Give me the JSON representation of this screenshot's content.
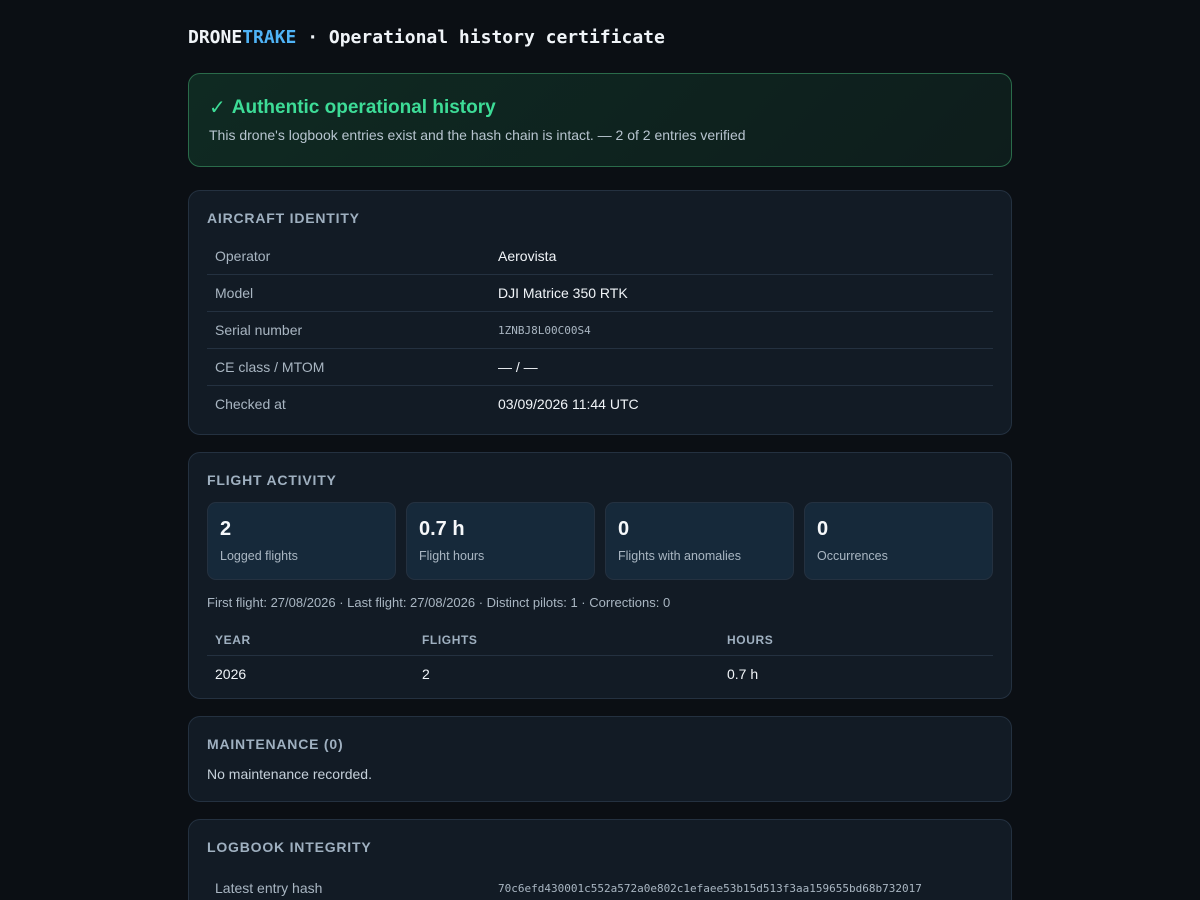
{
  "header": {
    "brand_part1": "DRONE",
    "brand_part2": "TRAKE",
    "title": " · Operational history certificate"
  },
  "banner": {
    "icon": "check-icon",
    "title": "Authentic operational history",
    "subtitle": "This drone's logbook entries exist and the hash chain is intact. — 2 of 2 entries verified"
  },
  "identity": {
    "title": "Aircraft identity",
    "rows": [
      {
        "key": "Operator",
        "value": "Aerovista"
      },
      {
        "key": "Model",
        "value": "DJI Matrice 350 RTK"
      },
      {
        "key": "Serial number",
        "value": "1ZNBJ8L00C00S4"
      },
      {
        "key": "CE class / MTOM",
        "value": "— / —"
      },
      {
        "key": "Checked at",
        "value": "03/09/2026 11:44 UTC"
      }
    ]
  },
  "activity": {
    "title": "Flight activity",
    "stats": [
      {
        "value": "2",
        "label": "Logged flights"
      },
      {
        "value": "0.7 h",
        "label": "Flight hours"
      },
      {
        "value": "0",
        "label": "Flights with anomalies"
      },
      {
        "value": "0",
        "label": "Occurrences"
      }
    ],
    "meta": "First flight: 27/08/2026 · Last flight: 27/08/2026 · Distinct pilots: 1 · Corrections: 0",
    "table": {
      "headers": [
        "YEAR",
        "FLIGHTS",
        "HOURS"
      ],
      "rows": [
        [
          "2026",
          "2",
          "0.7 h"
        ]
      ]
    }
  },
  "maintenance": {
    "title": "Maintenance (0)",
    "empty_text": "No maintenance recorded."
  },
  "integrity": {
    "title": "Logbook integrity",
    "rows": [
      {
        "key": "Latest entry hash",
        "value": "70c6efd430001c552a572a0e802c1efaee53b15d513f3aa159655bd68b732017"
      }
    ]
  }
}
